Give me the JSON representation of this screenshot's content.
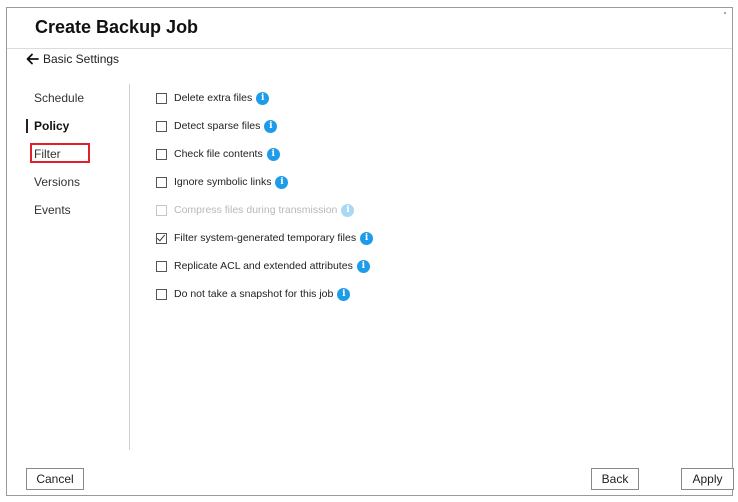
{
  "window": {
    "title": "Create Backup Job"
  },
  "back_link": {
    "label": "Basic Settings",
    "icon": "arrow-left-icon"
  },
  "nav": {
    "items": [
      {
        "label": "Schedule"
      },
      {
        "label": "Policy",
        "active": true
      },
      {
        "label": "Filter",
        "highlighted": true
      },
      {
        "label": "Versions"
      },
      {
        "label": "Events"
      }
    ]
  },
  "options": [
    {
      "label": "Delete extra files",
      "checked": false,
      "disabled": false
    },
    {
      "label": "Detect sparse files",
      "checked": false,
      "disabled": false
    },
    {
      "label": "Check file contents",
      "checked": false,
      "disabled": false
    },
    {
      "label": "Ignore symbolic links",
      "checked": false,
      "disabled": false
    },
    {
      "label": "Compress files during transmission",
      "checked": false,
      "disabled": true
    },
    {
      "label": "Filter system-generated temporary files",
      "checked": true,
      "disabled": false
    },
    {
      "label": "Replicate ACL and extended attributes",
      "checked": false,
      "disabled": false
    },
    {
      "label": "Do not take a snapshot for this job",
      "checked": false,
      "disabled": false
    }
  ],
  "info_icon": "i",
  "footer": {
    "cancel": "Cancel",
    "back": "Back",
    "apply": "Apply"
  },
  "colors": {
    "info": "#1e9be9",
    "highlight_border": "#e0202a"
  }
}
